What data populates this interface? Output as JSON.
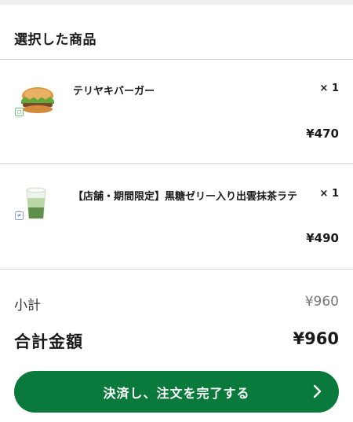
{
  "selected_section": {
    "title": "選択した商品"
  },
  "items": [
    {
      "name": "テリヤキバーガー",
      "quantity": "× 1",
      "price": "¥470",
      "thumb_icon": "teriyaki-burger-image"
    },
    {
      "name": "【店舗・期間限定】黒糖ゼリー入り出雲抹茶ラテ",
      "quantity": "× 1",
      "price": "¥490",
      "thumb_icon": "matcha-latte-image"
    }
  ],
  "summary": {
    "subtotal_label": "小計",
    "subtotal_value": "¥960",
    "total_label": "合計金額",
    "total_value": "¥960"
  },
  "checkout": {
    "button_label": "決済し、注文を完了する",
    "icon": "chevron-right-icon"
  },
  "colors": {
    "primary": "#0a7a3c",
    "divider": "#cfcfcf"
  }
}
